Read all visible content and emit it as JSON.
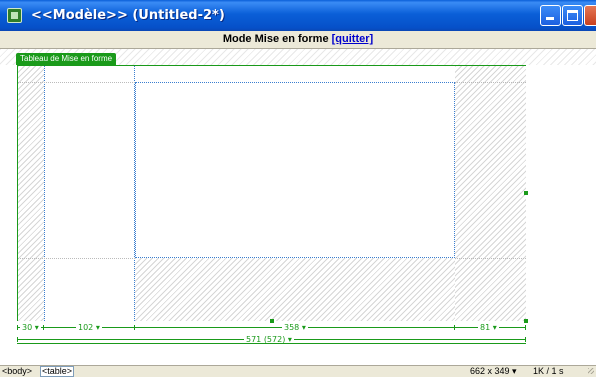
{
  "window": {
    "title": "<<Modèle>>  (Untitled-2*)",
    "controls": {
      "minimize": "minimize-icon",
      "maximize": "maximize-icon",
      "close": "close-icon"
    }
  },
  "mode_bar": {
    "label": "Mode Mise en forme ",
    "link": "[quitter]"
  },
  "design": {
    "table_tab": "Tableau de Mise en forme",
    "column_widths": [
      "30 ▾",
      "102 ▾",
      "358 ▾",
      "81 ▾"
    ],
    "total_width": "571 (572) ▾"
  },
  "status_bar": {
    "tags": [
      "<body>",
      "<table>"
    ],
    "dimensions": "662 x 349 ▾",
    "download": "1K / 1 s"
  },
  "colors": {
    "titlebar": "#0a5fd8",
    "layout_green": "#1a9a1a",
    "cell_outline": "#3c7fd0",
    "link": "#0000cc"
  }
}
